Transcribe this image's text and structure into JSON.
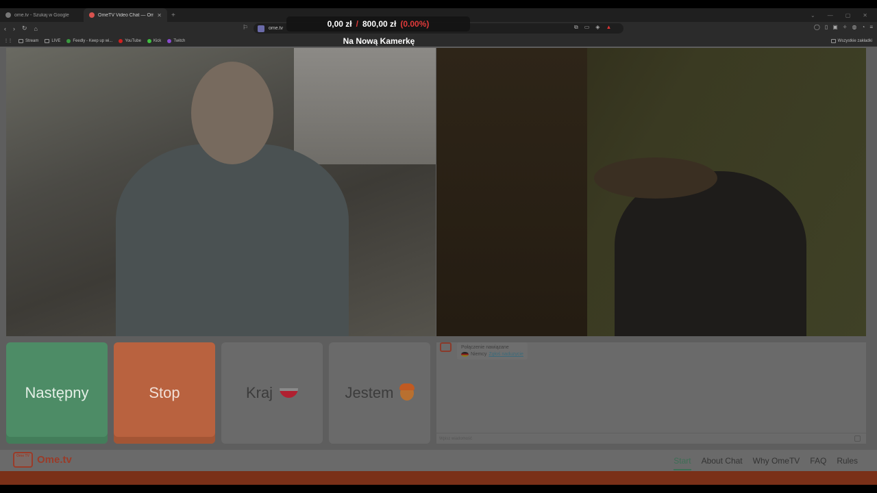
{
  "browser": {
    "tabs": [
      {
        "title": "ome.tv - Szukaj w Google",
        "active": false
      },
      {
        "title": "OmeTV Video Chat — Omeg...",
        "active": true
      }
    ],
    "new_tab": "+",
    "url": "ome.tv",
    "bookmarks": [
      "Stream",
      "LIVE",
      "Feedly - Keep up wi...",
      "YouTube",
      "Kick",
      "Twitch"
    ],
    "bookmarks_right": "Wszystkie zakładki"
  },
  "overlay": {
    "amount_current": "0,00 zł",
    "separator": "/",
    "amount_goal": "800,00 zł",
    "percent": "(0.00%)",
    "stream_title": "Na Nową Kamerkę"
  },
  "controls": {
    "next_label": "Następny",
    "stop_label": "Stop",
    "country_label": "Kraj",
    "me_label": "Jestem"
  },
  "chat": {
    "status": "Połączenie nawiązane",
    "country": "Niemcy",
    "report_link": "Zgłoś naduzycie",
    "input_placeholder": "Wpisz wiadomość"
  },
  "site": {
    "logo_tv_text": "Ome TV",
    "brand": "Ome.tv",
    "nav": [
      "Start",
      "About Chat",
      "Why OmeTV",
      "FAQ",
      "Rules"
    ],
    "active_nav": "Start"
  },
  "colors": {
    "next": "#4d8c66",
    "stop": "#b9623f",
    "brand": "#9a3b28",
    "overlay_red": "#e23a3a"
  }
}
